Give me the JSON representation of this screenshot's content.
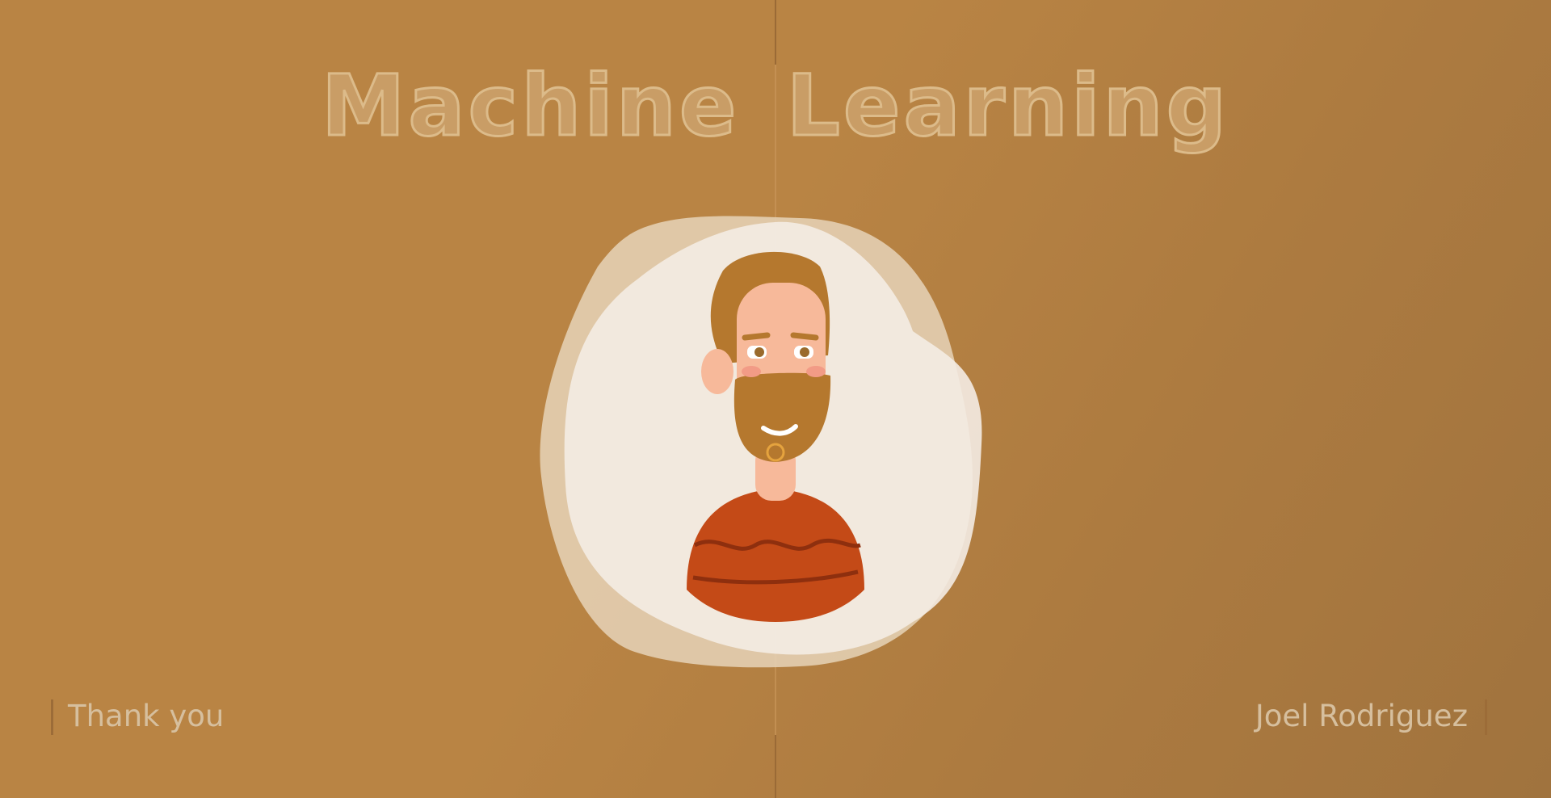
{
  "title": "Machine Learning",
  "footer": {
    "left": "Thank you",
    "right": "Joel Rodriguez"
  },
  "colors": {
    "background": "#b98444",
    "blob": "#f3ebe3",
    "shirt": "#c44a17",
    "hair": "#b5782e",
    "skin": "#f7b99a"
  },
  "illustration": "bearded-man-avatar"
}
